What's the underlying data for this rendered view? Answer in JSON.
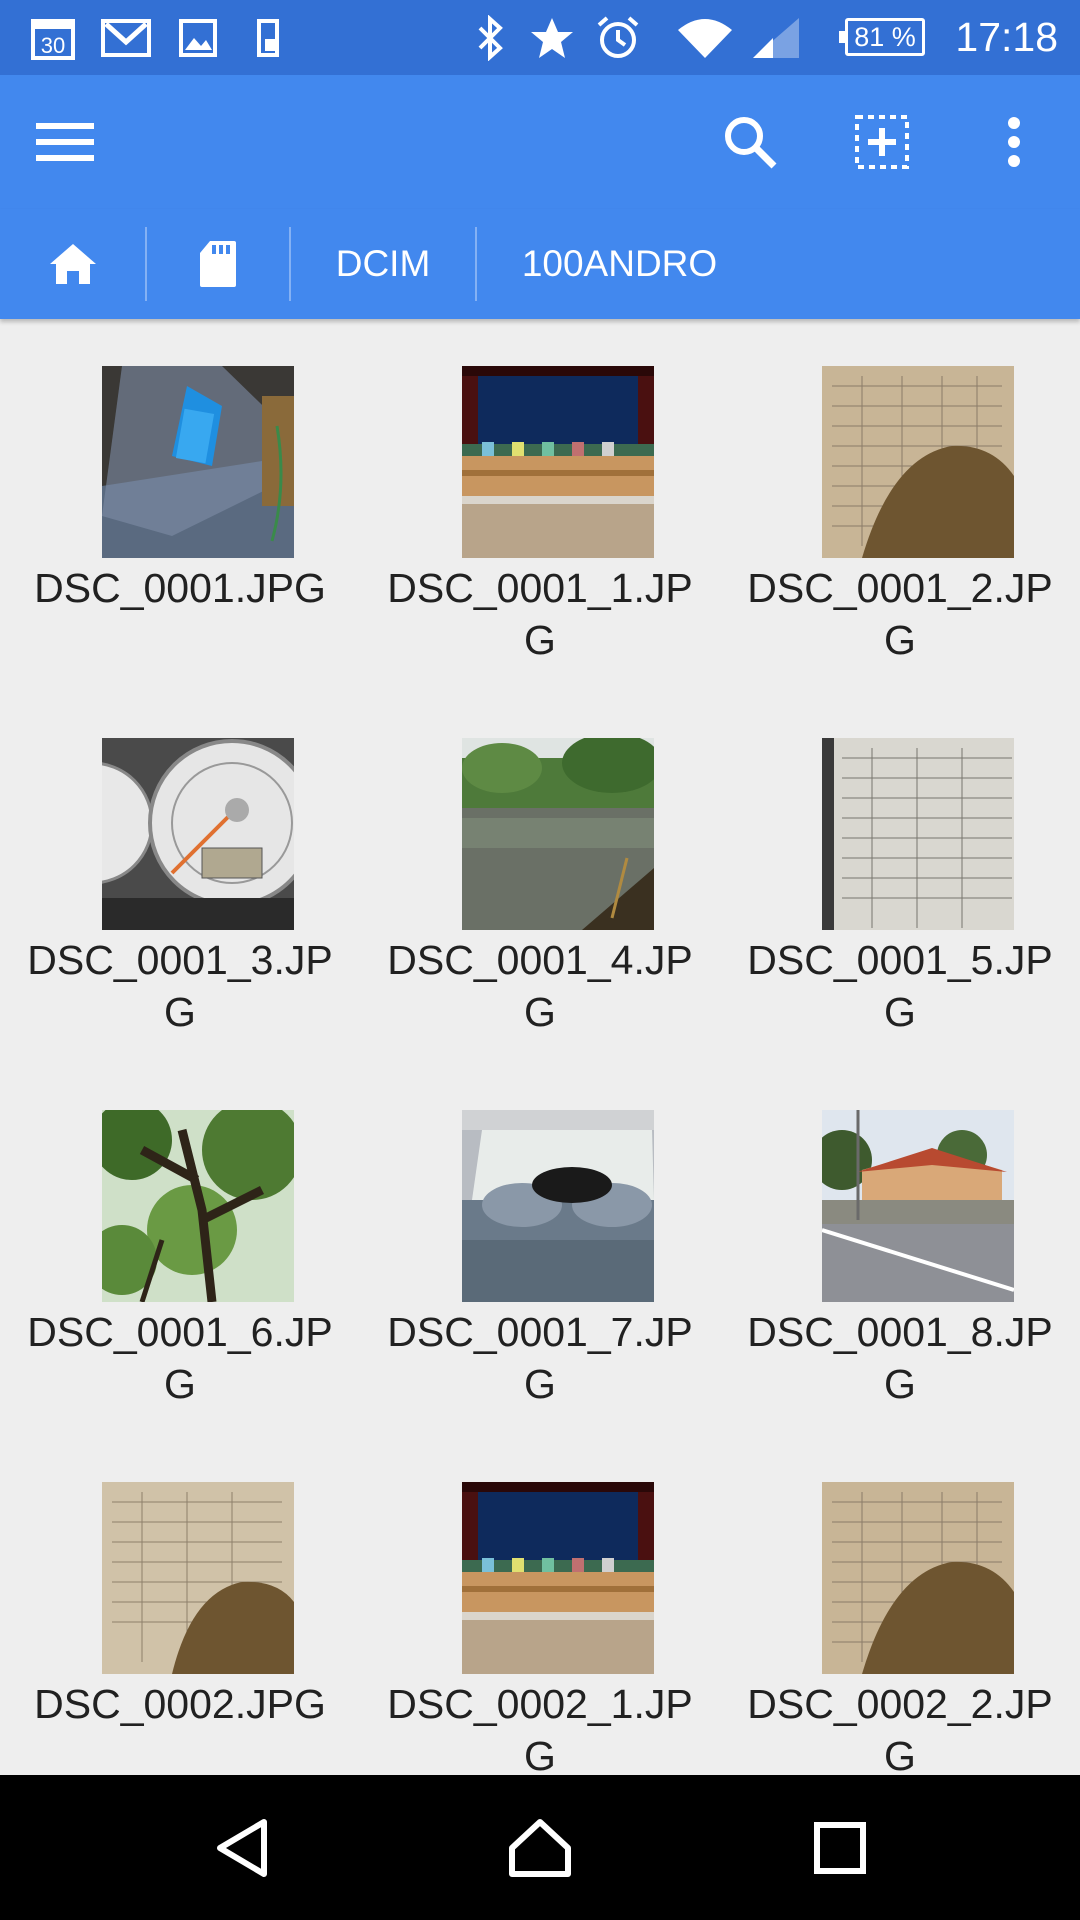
{
  "status_bar": {
    "time": "17:18",
    "battery": "81 %",
    "left_icons": [
      "calendar-icon",
      "gmail-icon",
      "gallery-icon",
      "sim-icon"
    ],
    "calendar_day": "30",
    "right_icons": [
      "bluetooth-icon",
      "star-icon",
      "alarm-icon",
      "wifi-icon",
      "signal-icon",
      "battery-icon"
    ]
  },
  "toolbar": {
    "menu_icon": "menu-icon",
    "search_icon": "search-icon",
    "select_icon": "select-add-icon",
    "more_icon": "more-vert-icon"
  },
  "breadcrumb": {
    "home_icon": "home-icon",
    "sd_icon": "sd-card-icon",
    "items": [
      "DCIM",
      "100ANDRO"
    ]
  },
  "files": [
    {
      "name": "DSC_0001.JPG",
      "thumb": "cable-photo"
    },
    {
      "name": "DSC_0001_1.JPG",
      "thumb": "stage-photo"
    },
    {
      "name": "DSC_0001_2.JPG",
      "thumb": "document-photo"
    },
    {
      "name": "DSC_0001_3.JPG",
      "thumb": "speedometer-photo"
    },
    {
      "name": "DSC_0001_4.JPG",
      "thumb": "river-photo"
    },
    {
      "name": "DSC_0001_5.JPG",
      "thumb": "document-photo"
    },
    {
      "name": "DSC_0001_6.JPG",
      "thumb": "tree-photo"
    },
    {
      "name": "DSC_0001_7.JPG",
      "thumb": "car-seat-photo"
    },
    {
      "name": "DSC_0001_8.JPG",
      "thumb": "house-road-photo"
    },
    {
      "name": "DSC_0002.JPG",
      "thumb": "document-photo"
    },
    {
      "name": "DSC_0002_1.JPG",
      "thumb": "stage-photo"
    },
    {
      "name": "DSC_0002_2.JPG",
      "thumb": "document-photo"
    }
  ],
  "nav_bar": {
    "back_icon": "back-icon",
    "home_icon": "home-nav-icon",
    "recents_icon": "recents-icon"
  },
  "colors": {
    "status_bar": "#3370d4",
    "app_bar": "#4288ee",
    "background": "#eeeeee",
    "nav_bar": "#000000"
  }
}
